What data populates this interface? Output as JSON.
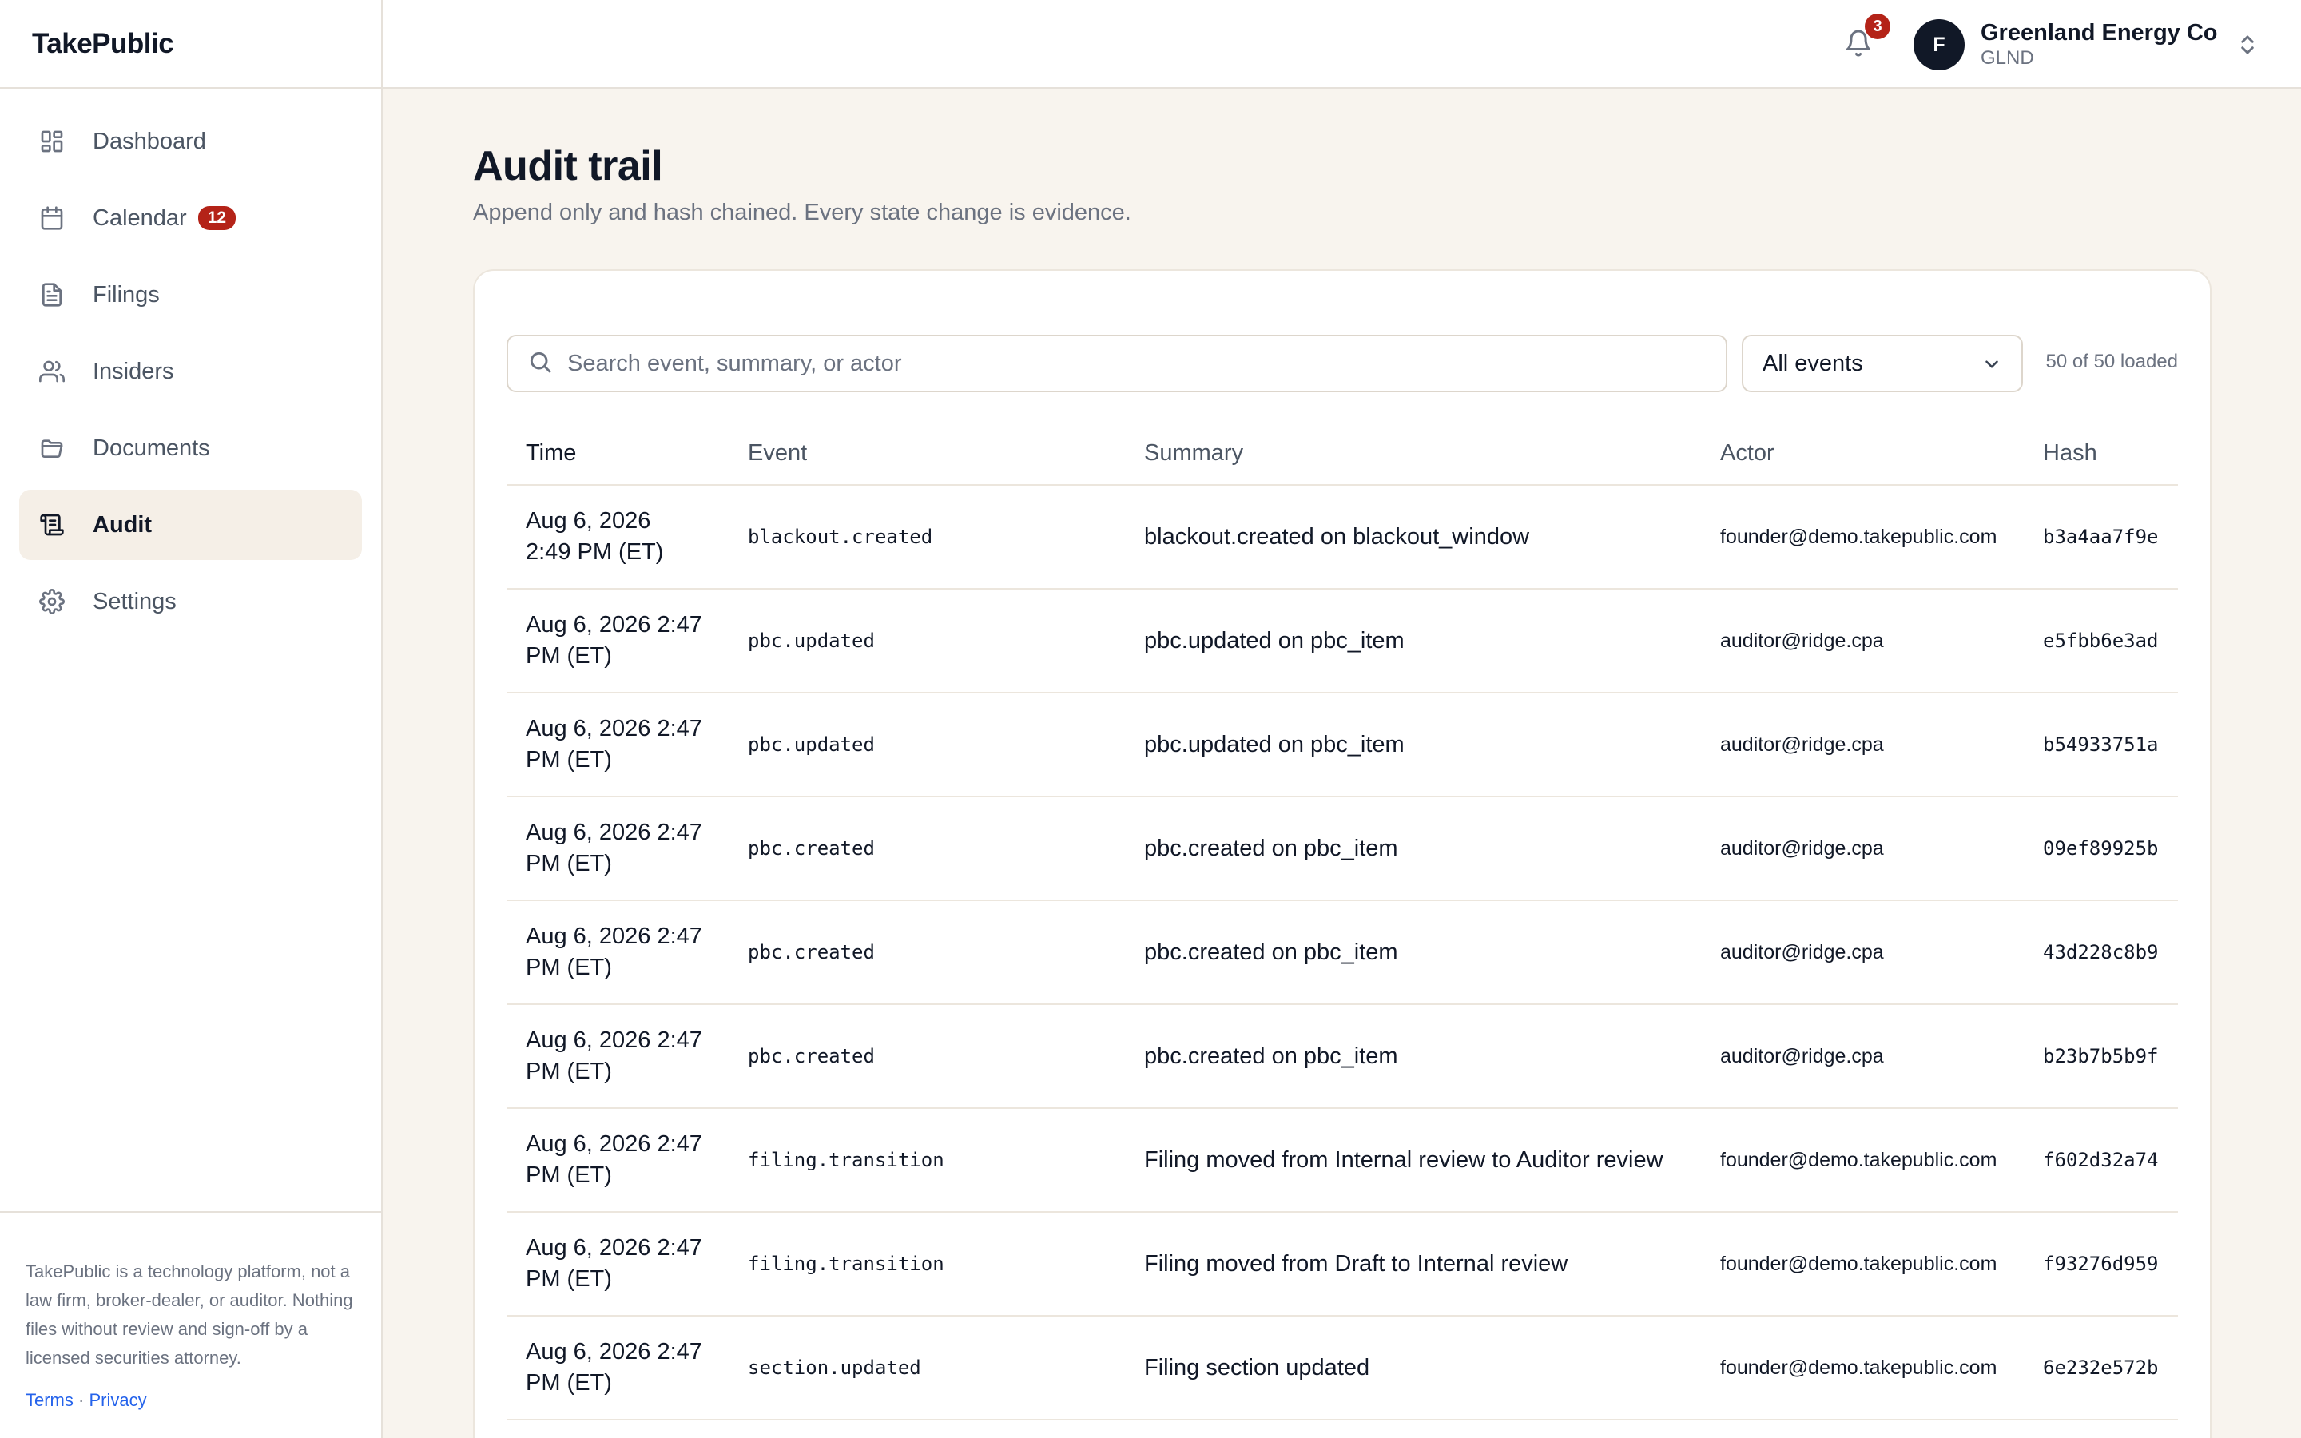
{
  "app": {
    "brand": "TakePublic"
  },
  "sidebar": {
    "items": [
      {
        "label": "Dashboard",
        "icon": "dashboard-icon"
      },
      {
        "label": "Calendar",
        "icon": "calendar-icon",
        "badge": "12"
      },
      {
        "label": "Filings",
        "icon": "file-text-icon"
      },
      {
        "label": "Insiders",
        "icon": "users-icon"
      },
      {
        "label": "Documents",
        "icon": "folder-icon"
      },
      {
        "label": "Audit",
        "icon": "audit-scroll-icon",
        "active": true
      },
      {
        "label": "Settings",
        "icon": "gear-icon"
      }
    ],
    "disclaimer": "TakePublic is a technology platform, not a law firm, broker-dealer, or auditor. Nothing files without review and sign-off by a licensed securities attorney.",
    "terms": "Terms",
    "separator": "·",
    "privacy": "Privacy"
  },
  "topbar": {
    "notification_count": "3",
    "avatar_initial": "F",
    "org_name": "Greenland Energy Co",
    "org_ticker": "GLND"
  },
  "page": {
    "title": "Audit trail",
    "subtitle": "Append only and hash chained. Every state change is evidence."
  },
  "filters": {
    "search_placeholder": "Search event, summary, or actor",
    "search_value": "",
    "event_filter": "All events",
    "loaded": "50 of 50 loaded"
  },
  "table": {
    "columns": [
      "Time",
      "Event",
      "Summary",
      "Actor",
      "Hash"
    ],
    "rows": [
      {
        "time_line1": "Aug 6, 2026",
        "time_line2": "2:49 PM (ET)",
        "event": "blackout.created",
        "summary": "blackout.created on blackout_window",
        "actor": "founder@demo.takepublic.com",
        "hash": "b3a4aa7f9e"
      },
      {
        "time_line1": "Aug 6, 2026 2:47",
        "time_line2": "PM (ET)",
        "event": "pbc.updated",
        "summary": "pbc.updated on pbc_item",
        "actor": "auditor@ridge.cpa",
        "hash": "e5fbb6e3ad"
      },
      {
        "time_line1": "Aug 6, 2026 2:47",
        "time_line2": "PM (ET)",
        "event": "pbc.updated",
        "summary": "pbc.updated on pbc_item",
        "actor": "auditor@ridge.cpa",
        "hash": "b54933751a"
      },
      {
        "time_line1": "Aug 6, 2026 2:47",
        "time_line2": "PM (ET)",
        "event": "pbc.created",
        "summary": "pbc.created on pbc_item",
        "actor": "auditor@ridge.cpa",
        "hash": "09ef89925b"
      },
      {
        "time_line1": "Aug 6, 2026 2:47",
        "time_line2": "PM (ET)",
        "event": "pbc.created",
        "summary": "pbc.created on pbc_item",
        "actor": "auditor@ridge.cpa",
        "hash": "43d228c8b9"
      },
      {
        "time_line1": "Aug 6, 2026 2:47",
        "time_line2": "PM (ET)",
        "event": "pbc.created",
        "summary": "pbc.created on pbc_item",
        "actor": "auditor@ridge.cpa",
        "hash": "b23b7b5b9f"
      },
      {
        "time_line1": "Aug 6, 2026 2:47",
        "time_line2": "PM (ET)",
        "event": "filing.transition",
        "summary": "Filing moved from Internal review to Auditor review",
        "actor": "founder@demo.takepublic.com",
        "hash": "f602d32a74"
      },
      {
        "time_line1": "Aug 6, 2026 2:47",
        "time_line2": "PM (ET)",
        "event": "filing.transition",
        "summary": "Filing moved from Draft to Internal review",
        "actor": "founder@demo.takepublic.com",
        "hash": "f93276d959"
      },
      {
        "time_line1": "Aug 6, 2026 2:47",
        "time_line2": "PM (ET)",
        "event": "section.updated",
        "summary": "Filing section updated",
        "actor": "founder@demo.takepublic.com",
        "hash": "6e232e572b"
      }
    ]
  },
  "colors": {
    "page_bg": "#f8f4ee",
    "badge_red": "#b42318",
    "avatar_bg": "#111827",
    "link_blue": "#2563eb"
  }
}
